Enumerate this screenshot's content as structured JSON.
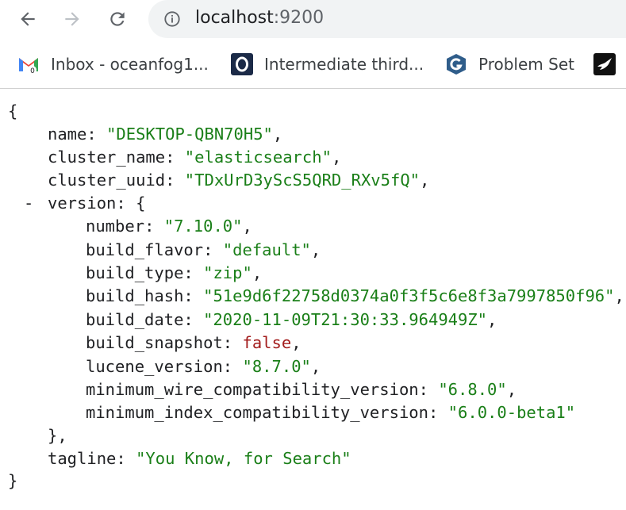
{
  "browser": {
    "url_host": "localhost",
    "url_port": ":9200",
    "bookmarks": [
      {
        "label": "Inbox - oceanfog1...",
        "icon": "gmail-icon"
      },
      {
        "label": "Intermediate third...",
        "icon": "o-site-icon"
      },
      {
        "label": "Problem Set",
        "icon": "g-site-icon"
      },
      {
        "label": "",
        "icon": "bird-icon"
      }
    ]
  },
  "json": {
    "open_brace": "{",
    "close_brace": "}",
    "name_key": "name",
    "name_val": "\"DESKTOP-QBN70H5\"",
    "cluster_name_key": "cluster_name",
    "cluster_name_val": "\"elasticsearch\"",
    "cluster_uuid_key": "cluster_uuid",
    "cluster_uuid_val": "\"TDxUrD3yScS5QRD_RXv5fQ\"",
    "version_toggle": "-",
    "version_key": "version",
    "version_open": "{",
    "version_close": "},",
    "version": {
      "number_key": "number",
      "number_val": "\"7.10.0\"",
      "build_flavor_key": "build_flavor",
      "build_flavor_val": "\"default\"",
      "build_type_key": "build_type",
      "build_type_val": "\"zip\"",
      "build_hash_key": "build_hash",
      "build_hash_val": "\"51e9d6f22758d0374a0f3f5c6e8f3a7997850f96\"",
      "build_date_key": "build_date",
      "build_date_val": "\"2020-11-09T21:30:33.964949Z\"",
      "build_snapshot_key": "build_snapshot",
      "build_snapshot_val": "false",
      "lucene_version_key": "lucene_version",
      "lucene_version_val": "\"8.7.0\"",
      "min_wire_key": "minimum_wire_compatibility_version",
      "min_wire_val": "\"6.8.0\"",
      "min_index_key": "minimum_index_compatibility_version",
      "min_index_val": "\"6.0.0-beta1\""
    },
    "tagline_key": "tagline",
    "tagline_val": "\"You Know, for Search\""
  }
}
